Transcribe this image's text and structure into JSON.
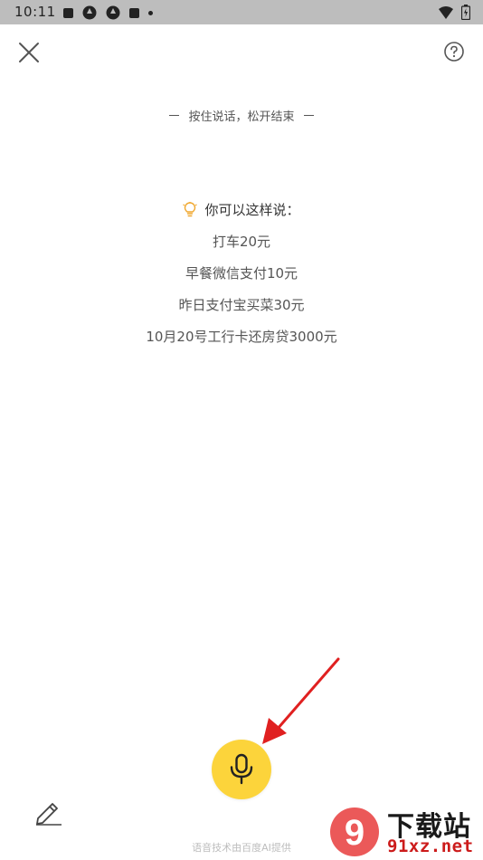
{
  "status_bar": {
    "time": "10:11"
  },
  "header": {
    "close_icon": "close-icon",
    "help_icon": "help-question-icon"
  },
  "hint": {
    "text": "按住说话，松开结束"
  },
  "suggestions": {
    "title": "你可以这样说：",
    "icon": "lightbulb-icon",
    "items": [
      "打车20元",
      "早餐微信支付10元",
      "昨日支付宝买菜30元",
      "10月20号工行卡还房贷3000元"
    ]
  },
  "mic": {
    "icon": "microphone-icon",
    "color": "#fcd43b"
  },
  "edit": {
    "icon": "pencil-icon"
  },
  "footer": {
    "credit": "语音技术由百度AI提供"
  },
  "watermark": {
    "logo_text": "9",
    "title": "下载站",
    "url": "91xz.net"
  },
  "colors": {
    "accent": "#fcd43b",
    "bulb": "#f0a830",
    "arrow": "#e02020"
  }
}
